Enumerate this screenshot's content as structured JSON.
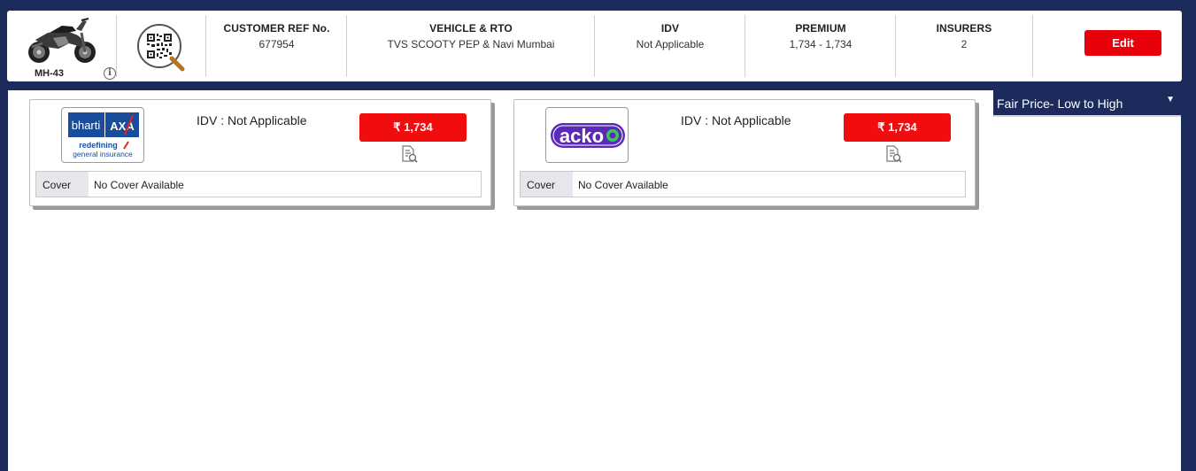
{
  "header": {
    "vehicle_code": "MH-43",
    "info_glyph": "i",
    "stats": [
      {
        "label": "CUSTOMER REF No.",
        "value": "677954"
      },
      {
        "label": "VEHICLE & RTO",
        "value": "TVS SCOOTY PEP & Navi Mumbai"
      },
      {
        "label": "IDV",
        "value": "Not Applicable"
      },
      {
        "label": "PREMIUM",
        "value": "1,734 - 1,734"
      },
      {
        "label": "INSURERS",
        "value": "2"
      }
    ],
    "edit_label": "Edit",
    "icons": {
      "vehicle": "motorcycle-icon",
      "qr": "qr-search-icon",
      "info": "info-icon"
    }
  },
  "sort": {
    "selected": "Fair Price- Low to High",
    "arrow": "▼"
  },
  "quotes": [
    {
      "insurer": "bharti AXA",
      "logo": {
        "brand": "bharti",
        "mark": "AXA",
        "tagline1": "redefining",
        "tagline2": "general insurance"
      },
      "idv": "IDV : Not Applicable",
      "price": "₹ 1,734",
      "cover_label": "Cover",
      "cover_value": "No Cover Available"
    },
    {
      "insurer": "acko",
      "logo": {
        "brand": "acko"
      },
      "idv": "IDV : Not Applicable",
      "price": "₹ 1,734",
      "cover_label": "Cover",
      "cover_value": "No Cover Available"
    }
  ],
  "colors": {
    "navy": "#1d2a5c",
    "accent_red": "#e8000b",
    "bharti_blue": "#1a4c9c",
    "axa_red": "#e2231a",
    "acko_purple": "#5b2bb8",
    "acko_green": "#3ec55a"
  }
}
